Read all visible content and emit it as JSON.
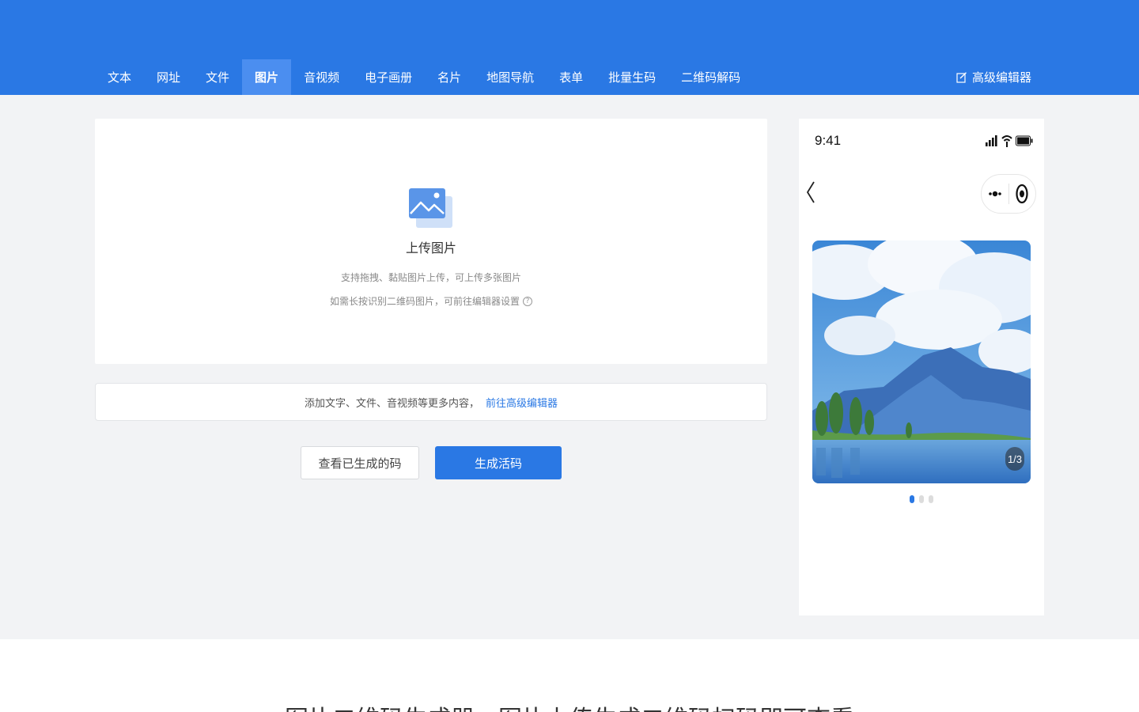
{
  "nav": {
    "items": [
      "文本",
      "网址",
      "文件",
      "图片",
      "音视频",
      "电子画册",
      "名片",
      "地图导航",
      "表单",
      "批量生码",
      "二维码解码"
    ],
    "active_index": 3,
    "advanced_editor": "高级编辑器"
  },
  "upload": {
    "title": "上传图片",
    "tip1": "支持拖拽、黏贴图片上传，可上传多张图片",
    "tip2": "如需长按识别二维码图片，可前往编辑器设置",
    "help_icon": "?"
  },
  "more": {
    "text": "添加文字、文件、音视频等更多内容，",
    "link": "前往高级编辑器"
  },
  "buttons": {
    "view": "查看已生成的码",
    "generate": "生成活码"
  },
  "phone": {
    "time": "9:41",
    "counter": "1/3",
    "total_dots": 3,
    "active_dot": 0
  },
  "bottom": {
    "title": "图片二维码生成器，图片上传生成二维码扫码即可查看"
  },
  "colors": {
    "primary": "#2a78e4",
    "nav_active": "#4b8ef0",
    "background": "#f2f3f5"
  }
}
